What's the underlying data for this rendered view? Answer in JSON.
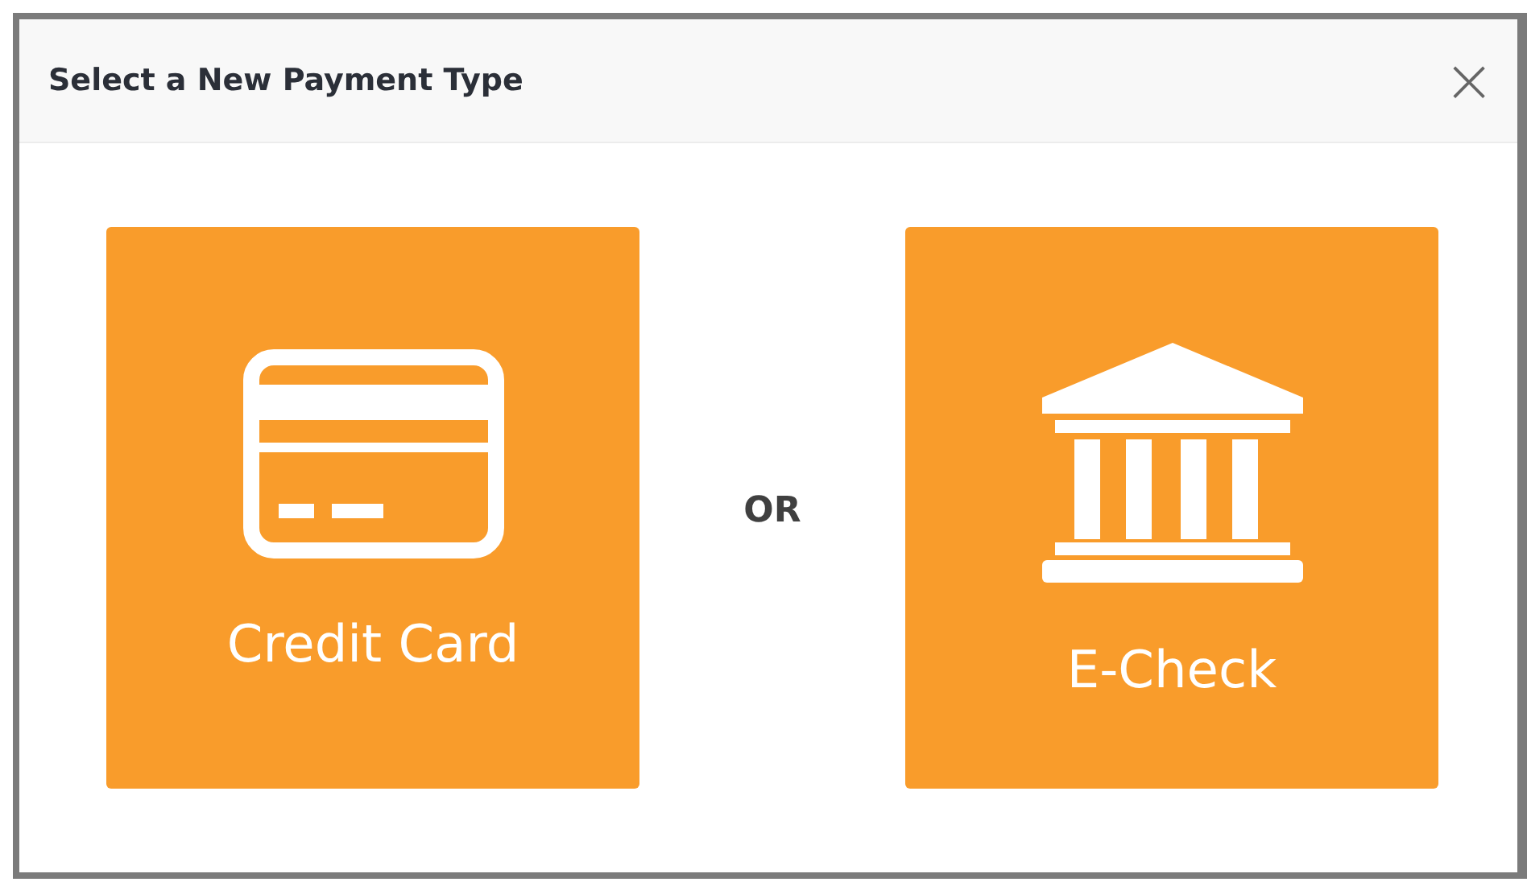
{
  "dialog": {
    "title": "Select a New Payment Type",
    "close": "×"
  },
  "options": [
    {
      "kind": "card",
      "label": "Credit Card"
    },
    {
      "kind": "bank",
      "label": "E-Check"
    }
  ],
  "separator": "OR"
}
